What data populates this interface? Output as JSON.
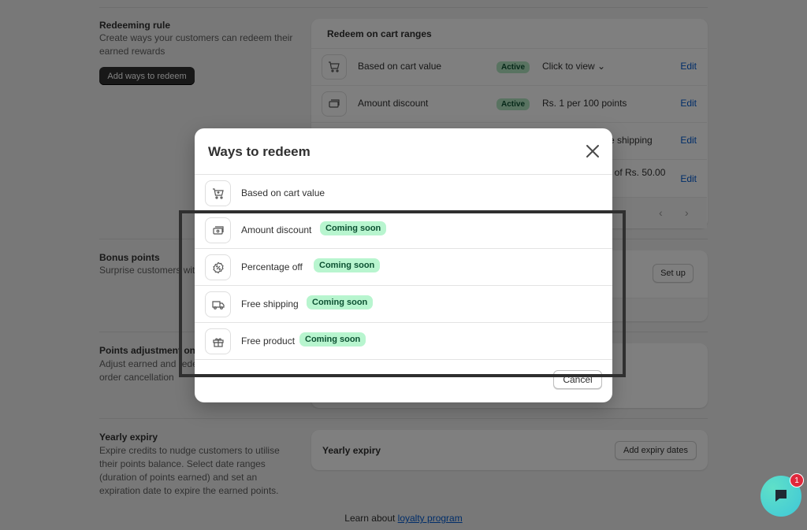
{
  "redeeming_rule": {
    "title": "Redeeming rule",
    "desc": "Create ways your customers can redeem their earned rewards",
    "button": "Add ways to redeem"
  },
  "cart_ranges": {
    "title": "Redeem on cart ranges",
    "rows": [
      {
        "label": "Based on cart value",
        "status": "Active",
        "value": "Click to view",
        "edit": "Edit"
      },
      {
        "label": "Amount discount",
        "status": "Active",
        "value": "Rs. 1 per 100 points",
        "edit": "Edit"
      },
      {
        "label": "",
        "status": "",
        "value": "e shipping",
        "edit": "Edit"
      },
      {
        "label": "",
        "status": "",
        "value": "t of Rs. 50.00",
        "edit": "Edit"
      }
    ]
  },
  "bonus_points": {
    "title": "Bonus points",
    "desc": "Surprise customers wit",
    "button": "Set up"
  },
  "points_adjustment": {
    "title": "Points adjustment on c",
    "desc_line1": "Adjust earned and rede",
    "desc_line2": "order cancellation"
  },
  "yearly_expiry": {
    "title": "Yearly expiry",
    "desc": "Expire credits to nudge customers to utilise their points balance. Select date ranges (duration of points earned) and set an expiration date to expire the earned points.",
    "card_label": "Yearly expiry",
    "button": "Add expiry dates"
  },
  "footer": {
    "text": "Learn about ",
    "link": "loyalty program"
  },
  "modal": {
    "title": "Ways to redeem",
    "items": [
      {
        "label": "Based on cart value",
        "badge": "",
        "icon": "cart-icon"
      },
      {
        "label": "Amount discount",
        "badge": "Coming soon",
        "icon": "cash-icon"
      },
      {
        "label": "Percentage off",
        "badge": "Coming soon",
        "icon": "discount-icon"
      },
      {
        "label": "Free shipping",
        "badge": "Coming soon",
        "icon": "truck-icon"
      },
      {
        "label": "Free product",
        "badge": "Coming soon",
        "icon": "gift-icon"
      }
    ],
    "cancel": "Cancel"
  },
  "chat": {
    "badge_count": "1"
  },
  "colors": {
    "badge_green": "#b8f5cf",
    "link_blue": "#005bd3",
    "chat_teal": "#3fc7d8",
    "notif_red": "#e0283c"
  }
}
